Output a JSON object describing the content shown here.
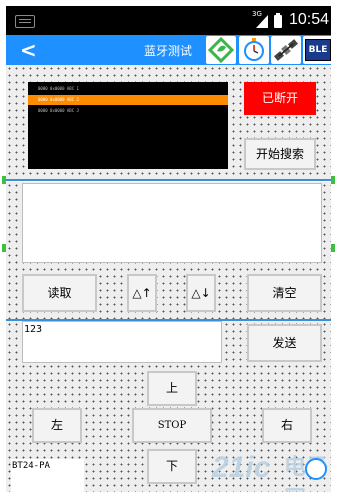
{
  "status_bar": {
    "network": "3G",
    "time": "10:54"
  },
  "action_bar": {
    "back_glyph": "<",
    "title": "蓝牙测试",
    "icons": [
      "refresh-leaf-icon",
      "stopwatch-icon",
      "satellite-icon",
      "ble-icon"
    ],
    "ble_label": "BLE"
  },
  "device_list": {
    "rows": [
      "0000 0x0000 ABC 1",
      "0000 0x0000 ABC 2",
      "0000 0x0000 ABC 3"
    ],
    "selected_color": "#ff8c00"
  },
  "connection": {
    "status_label": "已断开",
    "status_color": "#ff0000",
    "search_label": "开始搜索"
  },
  "controls": {
    "read_label": "读取",
    "up_label": "△↑",
    "down_label": "△↓",
    "clear_label": "清空"
  },
  "send": {
    "value": "123",
    "send_label": "发送"
  },
  "direction": {
    "forward": "上",
    "left": "左",
    "stop": "STOP",
    "right": "右",
    "backward": "下"
  },
  "device_name": "BT24-PA",
  "watermark": {
    "text": "21ic",
    "sub": "电子网"
  },
  "colors": {
    "accent": "#1e90ff",
    "divider": "#3a8fd6"
  }
}
